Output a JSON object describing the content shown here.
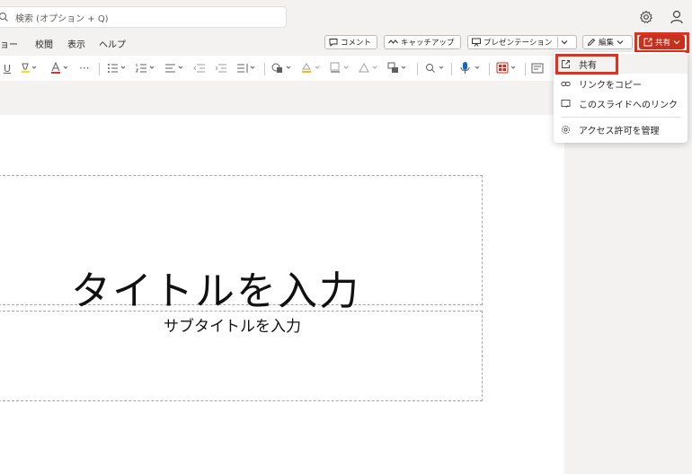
{
  "search": {
    "placeholder": "検索 (オプション + Q)"
  },
  "menubar": {
    "items": [
      {
        "label": "ョー"
      },
      {
        "label": "校閲"
      },
      {
        "label": "表示"
      },
      {
        "label": "ヘルプ"
      }
    ]
  },
  "toolbar": {
    "comment_label": "コメント",
    "catchup_label": "キャッチアップ",
    "present_label": "プレゼンテーション",
    "edit_label": "編集",
    "share_label": "共有"
  },
  "share_menu": {
    "items": [
      {
        "label": "共有",
        "icon": "share-icon"
      },
      {
        "label": "リンクをコピー",
        "icon": "link-icon"
      },
      {
        "label": "このスライドへのリンク",
        "icon": "slide-link-icon"
      },
      {
        "label": "アクセス許可を管理",
        "icon": "gear-icon"
      }
    ]
  },
  "slide": {
    "title_placeholder": "タイトルを入力",
    "subtitle_placeholder": "サブタイトルを入力"
  },
  "colors": {
    "accent": "#c4321f",
    "highlight": "#e0301e"
  }
}
